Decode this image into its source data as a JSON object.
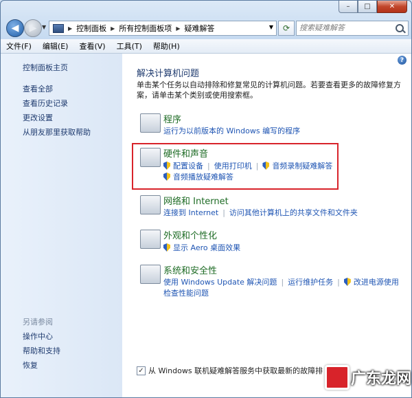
{
  "window": {
    "caption_buttons": {
      "minimize": "–",
      "maximize": "□",
      "close": "✕"
    }
  },
  "address_bar": {
    "breadcrumbs": [
      "控制面板",
      "所有控制面板项",
      "疑难解答"
    ],
    "search_placeholder": "搜索疑难解答"
  },
  "menu": [
    "文件(F)",
    "编辑(E)",
    "查看(V)",
    "工具(T)",
    "帮助(H)"
  ],
  "sidebar": {
    "home": "控制面板主页",
    "links": [
      "查看全部",
      "查看历史记录",
      "更改设置",
      "从朋友那里获取帮助"
    ],
    "see_also_title": "另请参阅",
    "see_also": [
      "操作中心",
      "帮助和支持",
      "恢复"
    ]
  },
  "main": {
    "title": "解决计算机问题",
    "description": "单击某个任务以自动排除和修复常见的计算机问题。若要查看更多的故障修复方案，请单击某个类别或使用搜索框。",
    "categories": [
      {
        "title": "程序",
        "links": [
          "运行为以前版本的 Windows 编写的程序"
        ]
      },
      {
        "title": "硬件和声音",
        "links": [
          "配置设备",
          "使用打印机",
          "音频录制疑难解答",
          "音频播放疑难解答"
        ]
      },
      {
        "title": "网络和 Internet",
        "links": [
          "连接到 Internet",
          "访问其他计算机上的共享文件和文件夹"
        ]
      },
      {
        "title": "外观和个性化",
        "links": [
          "显示 Aero 桌面效果"
        ]
      },
      {
        "title": "系统和安全性",
        "links": [
          "使用 Windows Update 解决问题",
          "运行维护任务",
          "改进电源使用",
          "检查性能问题"
        ]
      }
    ],
    "footer_checkbox": "从 Windows 联机疑难解答服务中获取最新的故障排"
  },
  "watermark": "广东龙网"
}
